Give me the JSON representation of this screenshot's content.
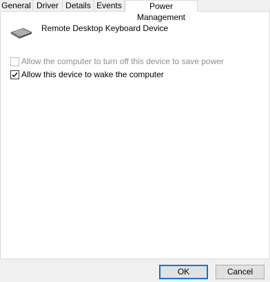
{
  "tabs": [
    {
      "label": "General"
    },
    {
      "label": "Driver"
    },
    {
      "label": "Details"
    },
    {
      "label": "Events"
    },
    {
      "label": "Power Management",
      "active": true
    }
  ],
  "device": {
    "name": "Remote Desktop Keyboard Device",
    "icon": "keyboard-icon"
  },
  "options": [
    {
      "label": "Allow the computer to turn off this device to save power",
      "checked": false,
      "enabled": false
    },
    {
      "label": "Allow this device to wake the computer",
      "checked": true,
      "enabled": true
    }
  ],
  "buttons": {
    "ok": "OK",
    "cancel": "Cancel"
  },
  "colors": {
    "accent": "#0078d7",
    "disabled_text": "#8d8d8d",
    "panel_bg": "#ffffff",
    "window_bg": "#f0f0f0"
  }
}
